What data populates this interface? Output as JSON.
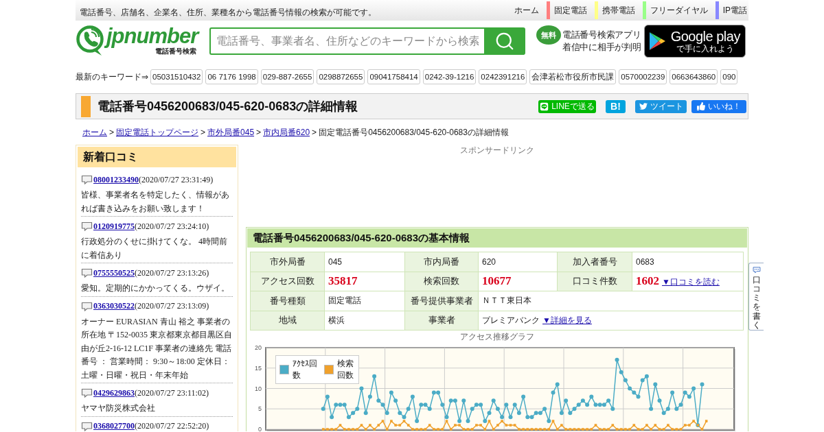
{
  "top_bar": {
    "tagline": "電話番号、店舗名、企業名、住所、業種名から電話番号情報の検索が可能です。",
    "nav": [
      {
        "label": "ホーム"
      },
      {
        "label": "固定電話",
        "color": "#ff7f7f"
      },
      {
        "label": "携帯電話",
        "color": "#ffff88"
      },
      {
        "label": "フリーダイヤル",
        "color": "#99ff88"
      },
      {
        "label": "IP電話",
        "color": "#8888ff"
      }
    ]
  },
  "header": {
    "logo": {
      "name": "jpnumber",
      "subtitle": "電話番号検索"
    },
    "search": {
      "placeholder": "電話番号、事業者名、住所などのキーワードから検索"
    },
    "app_promo": {
      "badge": "無料",
      "lines": [
        "電話番号検索アプリ",
        "着信中に相手が判明"
      ],
      "store_badge": {
        "title": "Google play",
        "subtitle": "で手に入れよう"
      }
    }
  },
  "keywords": {
    "label": "最新のキーワード⇒",
    "items": [
      "05031510432",
      "06 7176 1998",
      "029-887-2655",
      "0298872655",
      "09041758414",
      "0242-39-1216",
      "0242391216",
      "会津若松市役所市民課",
      "0570002239",
      "0663643860",
      "090"
    ]
  },
  "page_title": {
    "title": "電話番号0456200683/045-620-0683の詳細情報",
    "share_buttons": [
      {
        "kind": "line",
        "label": "LINEで送る"
      },
      {
        "kind": "hatena",
        "label": "B!"
      },
      {
        "kind": "tweet",
        "label": "ツイート"
      },
      {
        "kind": "like",
        "label": "いいね！"
      }
    ]
  },
  "breadcrumb": {
    "separator": ">",
    "links": [
      "ホーム",
      "固定電話トップページ",
      "市外局番045",
      "市内局番620"
    ],
    "current": "固定電話番号0456200683/045-620-0683の詳細情報"
  },
  "sidebar": {
    "title": "新着口コミ",
    "reviews": [
      {
        "number": "08001233490",
        "time": "(2020/07/27 23:31:49)",
        "comment": "皆様、事業者名を特定したく、情報があれば書き込みをお願い致します！"
      },
      {
        "number": "0120919775",
        "time": "(2020/07/27 23:24:10)",
        "comment": "行政処分のくせに掛けてくな。 4時間前に着信あり"
      },
      {
        "number": "0755550525",
        "time": "(2020/07/27 23:13:26)",
        "comment": "愛知。定期的にかかってくる。ウザイ。"
      },
      {
        "number": "0363030522",
        "time": "(2020/07/27 23:13:09)",
        "comment": "オーナー EURASIAN 青山 裕之 事業者の所在地 〒152-0035 東京都東京都目黒区自由が丘2-16-12 LC1F 事業者の連絡先 電話番号 ： 営業時間： 9:30～18:00 定休日：土曜・日曜・祝日・年末年始"
      },
      {
        "number": "0429629863",
        "time": "(2020/07/27 23:11:02)",
        "comment": "ヤマヤ防災株式会社"
      },
      {
        "number": "0368027700",
        "time": "(2020/07/27 22:52:20)"
      }
    ]
  },
  "sponsor_label": "スポンサードリンク",
  "basic_info": {
    "title": "電話番号0456200683/045-620-0683の基本情報",
    "rows": [
      [
        {
          "kind": "label",
          "text": "市外局番"
        },
        {
          "kind": "value",
          "text": "045"
        },
        {
          "kind": "label",
          "text": "市内局番"
        },
        {
          "kind": "value",
          "text": "620"
        },
        {
          "kind": "label",
          "text": "加入者番号"
        },
        {
          "kind": "value",
          "text": "0683"
        }
      ],
      [
        {
          "kind": "label",
          "text": "アクセス回数"
        },
        {
          "kind": "count",
          "text": "35817"
        },
        {
          "kind": "label",
          "text": "検索回数"
        },
        {
          "kind": "count",
          "text": "10677"
        },
        {
          "kind": "label",
          "text": "口コミ件数"
        },
        {
          "kind": "count",
          "text": "1602",
          "link": "▼口コミを読む"
        }
      ],
      [
        {
          "kind": "label",
          "text": "番号種類"
        },
        {
          "kind": "value",
          "text": "固定電話"
        },
        {
          "kind": "label",
          "text": "番号提供事業者"
        },
        {
          "kind": "value",
          "text": "ＮＴＴ東日本",
          "colspan": 3
        }
      ],
      [
        {
          "kind": "label",
          "text": "地域"
        },
        {
          "kind": "value",
          "text": "横浜"
        },
        {
          "kind": "label",
          "text": "事業者"
        },
        {
          "kind": "value",
          "text": "プレミアバンク",
          "link": "▼詳細を見る",
          "colspan": 3
        }
      ]
    ],
    "chart_data": {
      "type": "line",
      "title": "アクセス推移グラフ",
      "ylim": [
        0,
        20
      ],
      "yticks": [
        0,
        5,
        10,
        15,
        20
      ],
      "grid": true,
      "legend": "upper left",
      "series": [
        {
          "name": "ｱｸｾｽ回数",
          "color": "#4bacc6",
          "marker": "circle",
          "values": [
            null,
            null,
            null,
            null,
            null,
            null,
            null,
            null,
            null,
            null,
            null,
            null,
            null,
            5,
            8,
            3,
            6,
            6,
            6,
            3,
            4,
            5,
            10,
            4,
            8,
            13,
            7,
            6,
            4,
            9,
            7,
            4,
            3,
            5,
            8,
            2,
            6,
            6,
            5,
            9,
            9,
            6,
            3,
            7,
            7,
            2,
            7,
            2,
            5,
            6,
            6,
            2,
            4,
            7,
            5,
            3,
            6,
            3,
            6,
            4,
            8,
            3,
            3,
            4,
            4,
            5,
            2,
            9,
            11,
            4,
            7,
            4,
            5,
            6,
            7,
            6,
            8,
            6,
            6,
            6,
            7,
            5,
            17,
            14,
            12,
            10,
            9,
            8,
            12,
            13,
            5,
            11,
            7,
            4,
            5,
            9,
            5,
            6,
            9,
            8,
            10,
            1,
            11,
            null,
            null,
            null,
            null,
            null,
            null,
            null
          ]
        },
        {
          "name": "検索回数",
          "color": "#f0a12c",
          "marker": "square",
          "values": [
            null,
            null,
            null,
            null,
            null,
            null,
            null,
            null,
            null,
            null,
            null,
            null,
            null,
            0,
            0,
            0,
            0,
            1,
            0,
            0,
            0,
            0,
            1,
            0,
            1,
            0,
            1,
            2,
            0,
            2,
            1,
            1,
            2,
            1,
            0,
            0,
            0,
            0,
            1,
            0,
            0,
            0,
            2,
            0,
            1,
            1,
            0,
            0,
            0,
            1,
            1,
            0,
            2,
            0,
            1,
            2,
            1,
            1,
            1,
            0,
            0,
            0,
            0,
            0,
            0,
            0,
            0,
            2,
            0,
            1,
            0,
            0,
            0,
            0,
            0,
            0,
            0,
            1,
            0,
            0,
            0,
            1,
            0,
            0,
            0,
            0,
            1,
            0,
            0,
            1,
            0,
            1,
            0,
            0,
            1,
            0,
            0,
            0,
            1,
            1,
            2,
            1,
            0,
            2,
            null,
            null,
            null,
            null,
            null,
            null,
            null
          ]
        }
      ]
    }
  },
  "write_review_tab": {
    "label": "口コミを書く"
  }
}
